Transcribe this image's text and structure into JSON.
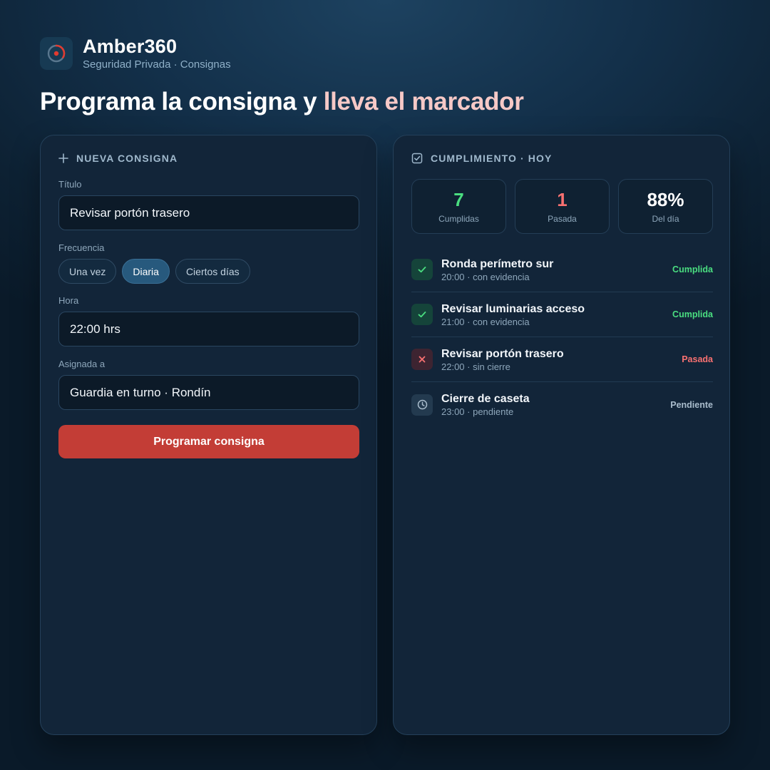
{
  "brand": {
    "name": "Amber360",
    "subtitle": "Seguridad Privada · Consignas",
    "accent_color": "#e23b30"
  },
  "headline": {
    "text": "Programa la consigna y ",
    "accent": "lleva el marcador",
    "accent_color": "#f6c9c7"
  },
  "form": {
    "section_title": "NUEVA CONSIGNA",
    "section_icon": "plus-icon",
    "title_label": "Título",
    "title_value": "Revisar portón trasero",
    "frequency_label": "Frecuencia",
    "frequency_options": [
      "Una vez",
      "Diaria",
      "Ciertos días"
    ],
    "frequency_selected": "Diaria",
    "time_label": "Hora",
    "time_value": "22:00 hrs",
    "assigned_label": "Asignada a",
    "assigned_value": "Guardia en turno · Rondín",
    "submit_label": "Programar consigna",
    "submit_color": "#c33d36"
  },
  "compliance": {
    "section_title": "CUMPLIMIENTO · HOY",
    "section_icon": "checkbox-icon",
    "stats": [
      {
        "value": "7",
        "label": "Cumplidas",
        "color": "#4ade80"
      },
      {
        "value": "1",
        "label": "Pasada",
        "color": "#f87171"
      },
      {
        "value": "88%",
        "label": "Del día",
        "color": "#ffffff"
      }
    ],
    "tasks": [
      {
        "name": "Ronda perímetro sur",
        "meta": "20:00 · con evidencia",
        "status": "Cumplida",
        "icon": "check-icon"
      },
      {
        "name": "Revisar luminarias acceso",
        "meta": "21:00 · con evidencia",
        "status": "Cumplida",
        "icon": "check-icon"
      },
      {
        "name": "Revisar portón trasero",
        "meta": "22:00 · sin cierre",
        "status": "Pasada",
        "icon": "x-icon"
      },
      {
        "name": "Cierre de caseta",
        "meta": "23:00 · pendiente",
        "status": "Pendiente",
        "icon": "clock-icon"
      }
    ],
    "status_colors": {
      "Cumplida": "#4ade80",
      "Pasada": "#f87171",
      "Pendiente": "#a9bccc"
    }
  }
}
